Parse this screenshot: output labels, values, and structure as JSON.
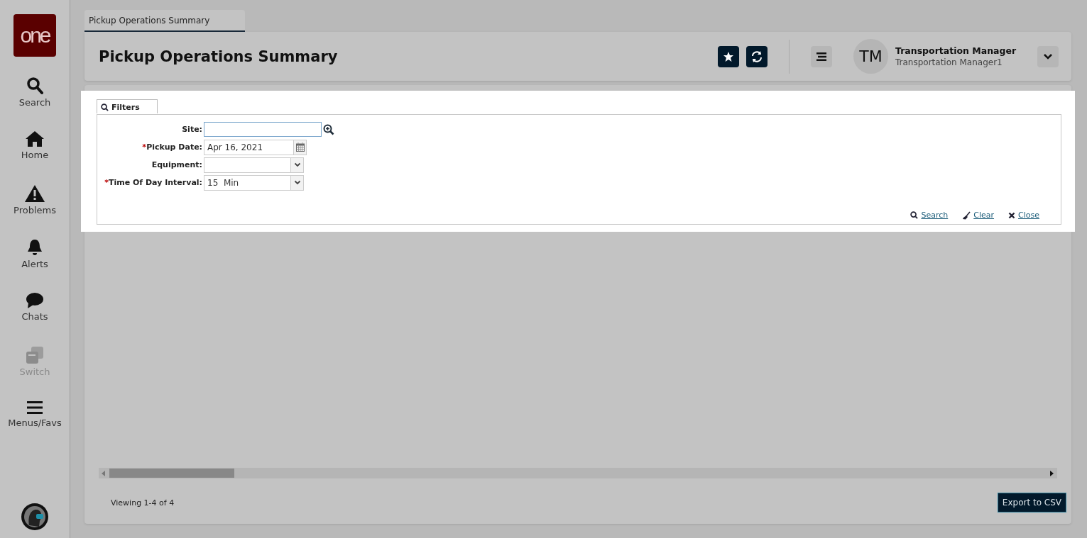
{
  "sidebar": {
    "logo": "one",
    "items": [
      {
        "label": "Search",
        "disabled": false
      },
      {
        "label": "Home",
        "disabled": false
      },
      {
        "label": "Problems",
        "disabled": false
      },
      {
        "label": "Alerts",
        "disabled": false
      },
      {
        "label": "Chats",
        "disabled": false
      },
      {
        "label": "Switch",
        "disabled": true
      },
      {
        "label": "Menus/Favs",
        "disabled": false
      }
    ]
  },
  "tabs": [
    {
      "label": "Pickup Operations Summary",
      "selected": true
    }
  ],
  "header": {
    "title": "Pickup Operations Summary",
    "user": {
      "initials": "TM",
      "name": "Transportation Manager",
      "role": "Transportation Manager1"
    }
  },
  "filters": {
    "title": "Filters",
    "fields": [
      {
        "kind": "lookup",
        "label": "Site:"
      },
      {
        "kind": "date",
        "label": "Pickup Date:",
        "required_mark": "*",
        "value": "Apr 16, 2021"
      },
      {
        "kind": "select",
        "label": "Equipment:"
      },
      {
        "kind": "select",
        "label": "Time Of Day Interval:",
        "required_mark": "*",
        "value": "15  Min"
      }
    ],
    "actions": [
      "Search",
      "Clear",
      "Close"
    ]
  },
  "footer": {
    "viewing": "Viewing 1-4 of 4",
    "export": "Export to CSV"
  }
}
